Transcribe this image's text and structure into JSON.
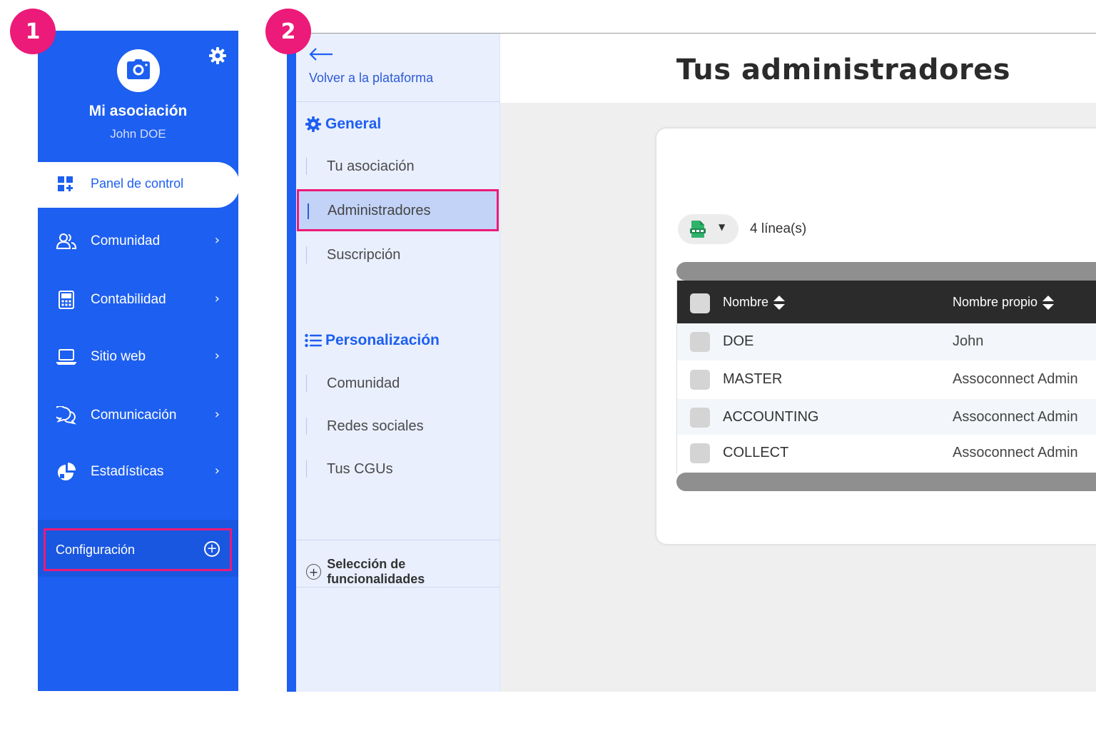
{
  "steps": [
    "1",
    "2"
  ],
  "sidebar": {
    "association_name": "Mi asociación",
    "user_name": "John DOE",
    "active_item": "Panel de control",
    "items": [
      {
        "label": "Comunidad",
        "icon": "users-icon"
      },
      {
        "label": "Contabilidad",
        "icon": "calculator-icon"
      },
      {
        "label": "Sitio web",
        "icon": "laptop-icon"
      },
      {
        "label": "Comunicación",
        "icon": "chat-icon"
      },
      {
        "label": "Estadísticas",
        "icon": "pie-chart-icon"
      }
    ],
    "config_label": "Configuración",
    "colors": {
      "background": "#1d5ff0",
      "highlight": "#ec1a78"
    }
  },
  "subnav": {
    "back_label": "Volver a la plataforma",
    "general_title": "General",
    "general_items": [
      "Tu asociación",
      "Administradores",
      "Suscripción"
    ],
    "active_item": "Administradores",
    "personalization_title": "Personalización",
    "personalization_items": [
      "Comunidad",
      "Redes sociales",
      "Tus CGUs"
    ],
    "features_label": "Selección de funcionalidades"
  },
  "main": {
    "title": "Tus administradores",
    "row_count": "4 línea(s)",
    "table": {
      "headers": [
        "Nombre",
        "Nombre propio"
      ],
      "rows": [
        [
          "DOE",
          "John"
        ],
        [
          "MASTER",
          "Assoconnect Admin"
        ],
        [
          "ACCOUNTING",
          "Assoconnect Admin"
        ],
        [
          "COLLECT",
          "Assoconnect Admin"
        ]
      ]
    }
  }
}
